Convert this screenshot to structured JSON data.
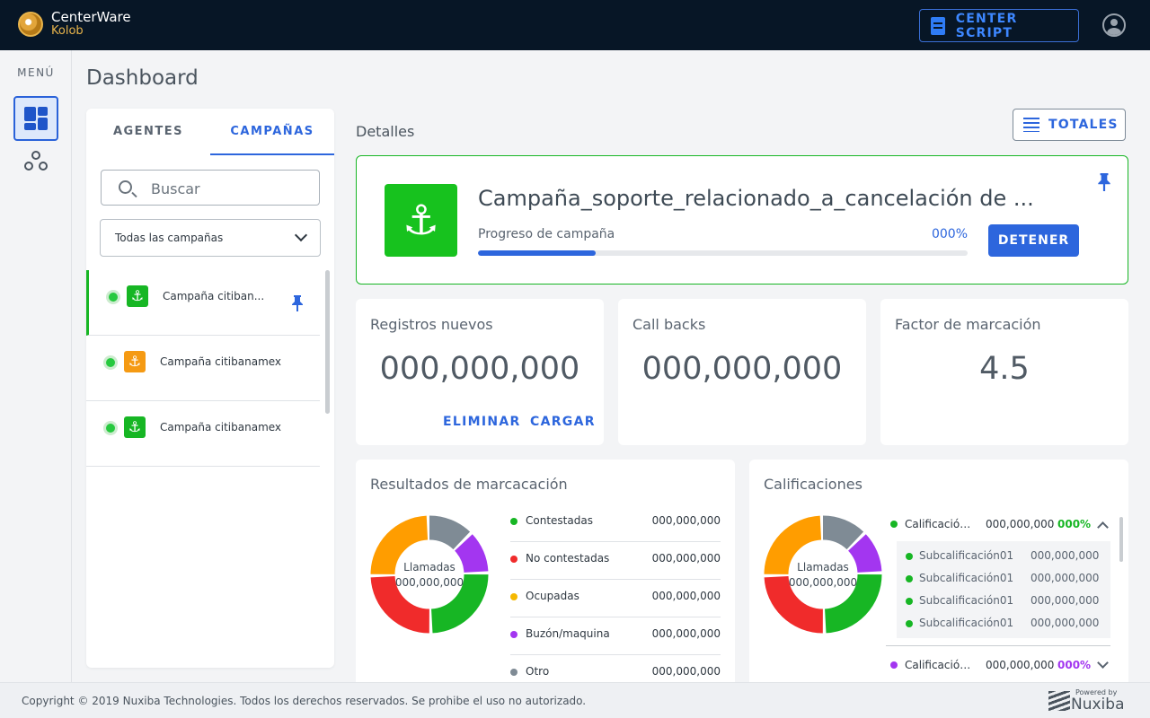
{
  "app": {
    "brand_name": "CenterWare",
    "brand_sub": "Kolob",
    "center_script_label": "CENTER SCRIPT"
  },
  "menu": {
    "label": "MENÚ"
  },
  "page": {
    "title": "Dashboard"
  },
  "campaign_panel": {
    "tabs": [
      {
        "label": "AGENTES",
        "active": false
      },
      {
        "label": "CAMPAÑAS",
        "active": true
      }
    ],
    "search_placeholder": "Buscar",
    "filter_selected": "Todas las campañas",
    "items": [
      {
        "name": "Campaña citiban...",
        "status": "active",
        "icon_color": "#17b624",
        "pinned": true,
        "selected": true
      },
      {
        "name": "Campaña citibanamex",
        "status": "active",
        "icon_color": "#f59a13",
        "pinned": false,
        "selected": false
      },
      {
        "name": "Campaña citibanamex",
        "status": "active",
        "icon_color": "#17b624",
        "pinned": false,
        "selected": false
      }
    ]
  },
  "details": {
    "title": "Detalles",
    "totales_label": "TOTALES",
    "campaign": {
      "name": "Campaña_soporte_relacionado_a_cancelación de ...",
      "progress_label": "Progreso de campaña",
      "progress_text": "000%",
      "progress_fraction": 0.24,
      "stop_label": "DETENER",
      "icon": "anchor-icon",
      "icon_color": "#17c21e"
    },
    "stats": [
      {
        "label": "Registros nuevos",
        "value": "000,000,000",
        "actions": [
          "ELIMINAR",
          "CARGAR"
        ]
      },
      {
        "label": "Call backs",
        "value": "000,000,000",
        "actions": []
      },
      {
        "label": "Factor de marcación",
        "value": "4.5",
        "actions": []
      }
    ]
  },
  "dial_results": {
    "title": "Resultados de marcacación",
    "center_label": "Llamadas",
    "center_value": "000,000,000",
    "legend": [
      {
        "name": "Contestadas",
        "value": "000,000,000",
        "color": "#17b624"
      },
      {
        "name": "No contestadas",
        "value": "000,000,000",
        "color": "#f02b2b"
      },
      {
        "name": "Ocupadas",
        "value": "000,000,000",
        "color": "#f5b800"
      },
      {
        "name": "Buzón/maquina",
        "value": "000,000,000",
        "color": "#a336f0"
      },
      {
        "name": "Otro",
        "value": "000,000,000",
        "color": "#7f8b95"
      }
    ],
    "segments": [
      {
        "color": "#7f8b95",
        "share": 0.13
      },
      {
        "color": "#a336f0",
        "share": 0.12
      },
      {
        "color": "#17b624",
        "share": 0.25
      },
      {
        "color": "#f02b2b",
        "share": 0.25
      },
      {
        "color": "#ff9d00",
        "share": 0.25
      }
    ]
  },
  "qualifications": {
    "title": "Calificaciones",
    "center_label": "Llamadas",
    "center_value": "000,000,000",
    "items": [
      {
        "name": "Calificación...",
        "value": "000,000,000",
        "percent": "000%",
        "color": "#17b624",
        "expanded": true,
        "subitems": [
          {
            "name": "Subcalificación01",
            "value": "000,000,000"
          },
          {
            "name": "Subcalificación01",
            "value": "000,000,000"
          },
          {
            "name": "Subcalificación01",
            "value": "000,000,000"
          },
          {
            "name": "Subcalificación01",
            "value": "000,000,000"
          }
        ]
      },
      {
        "name": "Calificación...",
        "value": "000,000,000",
        "percent": "000%",
        "color": "#a336f0",
        "expanded": false,
        "subitems": []
      }
    ]
  },
  "footer": {
    "copyright": "Copyright © 2019 Nuxiba Technologies. Todos los derechos reservados. Se prohibe el uso no autorizado.",
    "powered_by": "Powered by",
    "powered_brand": "Nuxiba"
  }
}
